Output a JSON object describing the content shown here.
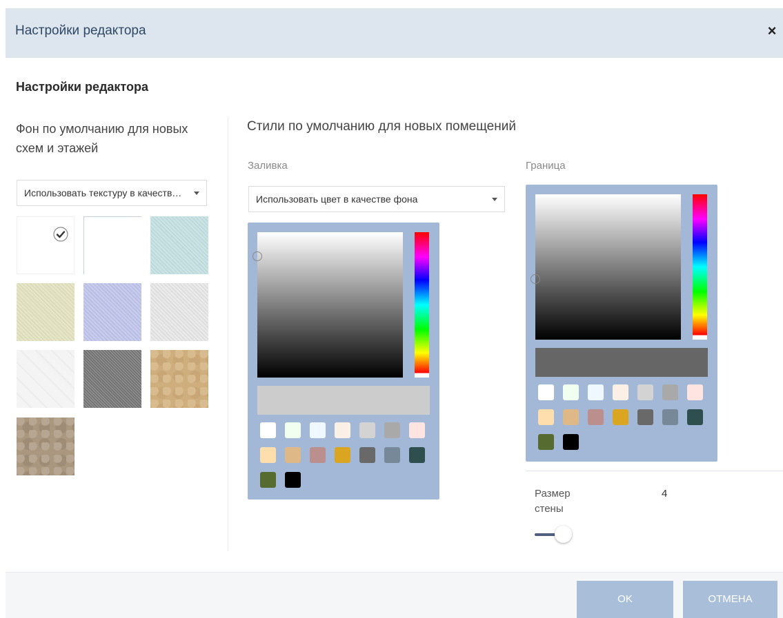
{
  "dialog": {
    "title": "Настройки редактора",
    "close_glyph": "×"
  },
  "section": {
    "title": "Настройки редактора"
  },
  "background": {
    "heading": "Фон по умолчанию для новых схем и этажей",
    "select_value": "Использовать текстуру в качестве фона",
    "textures": [
      "white-selected",
      "white",
      "light-cyan-linen",
      "beige-linen",
      "lavender-linen",
      "light-gray-linen",
      "white-quilt",
      "gray-granite",
      "tan-leather",
      "gray-leather"
    ],
    "selected_texture": "white-selected"
  },
  "styles": {
    "heading": "Стили по умолчанию для новых помещений",
    "fill": {
      "label": "Заливка",
      "select_value": "Использовать цвет в качестве фона",
      "preview_color": "#cccccc",
      "hue_color": "#ff0000"
    },
    "border": {
      "label": "Граница",
      "preview_color": "#666666",
      "hue_color": "#ff0000"
    },
    "palette": [
      "#ffffff",
      "#f0fff0",
      "#f0f8ff",
      "#faf0e6",
      "#d3d3d3",
      "#a9a9a9",
      "#ffe4e1",
      "#ffdead",
      "#deb887",
      "#bc8f8f",
      "#daa520",
      "#696969",
      "#778899",
      "#2f4f4f",
      "#556b2f",
      "#000000"
    ],
    "wall_size": {
      "label": "Размер стены",
      "value": "4"
    }
  },
  "footer": {
    "ok_label": "OK",
    "cancel_label": "ОТМЕНА"
  },
  "colors": {
    "header_bg": "#dde5ef",
    "picker_bg": "#a2b8d6",
    "button_bg": "#a9bfd9"
  }
}
